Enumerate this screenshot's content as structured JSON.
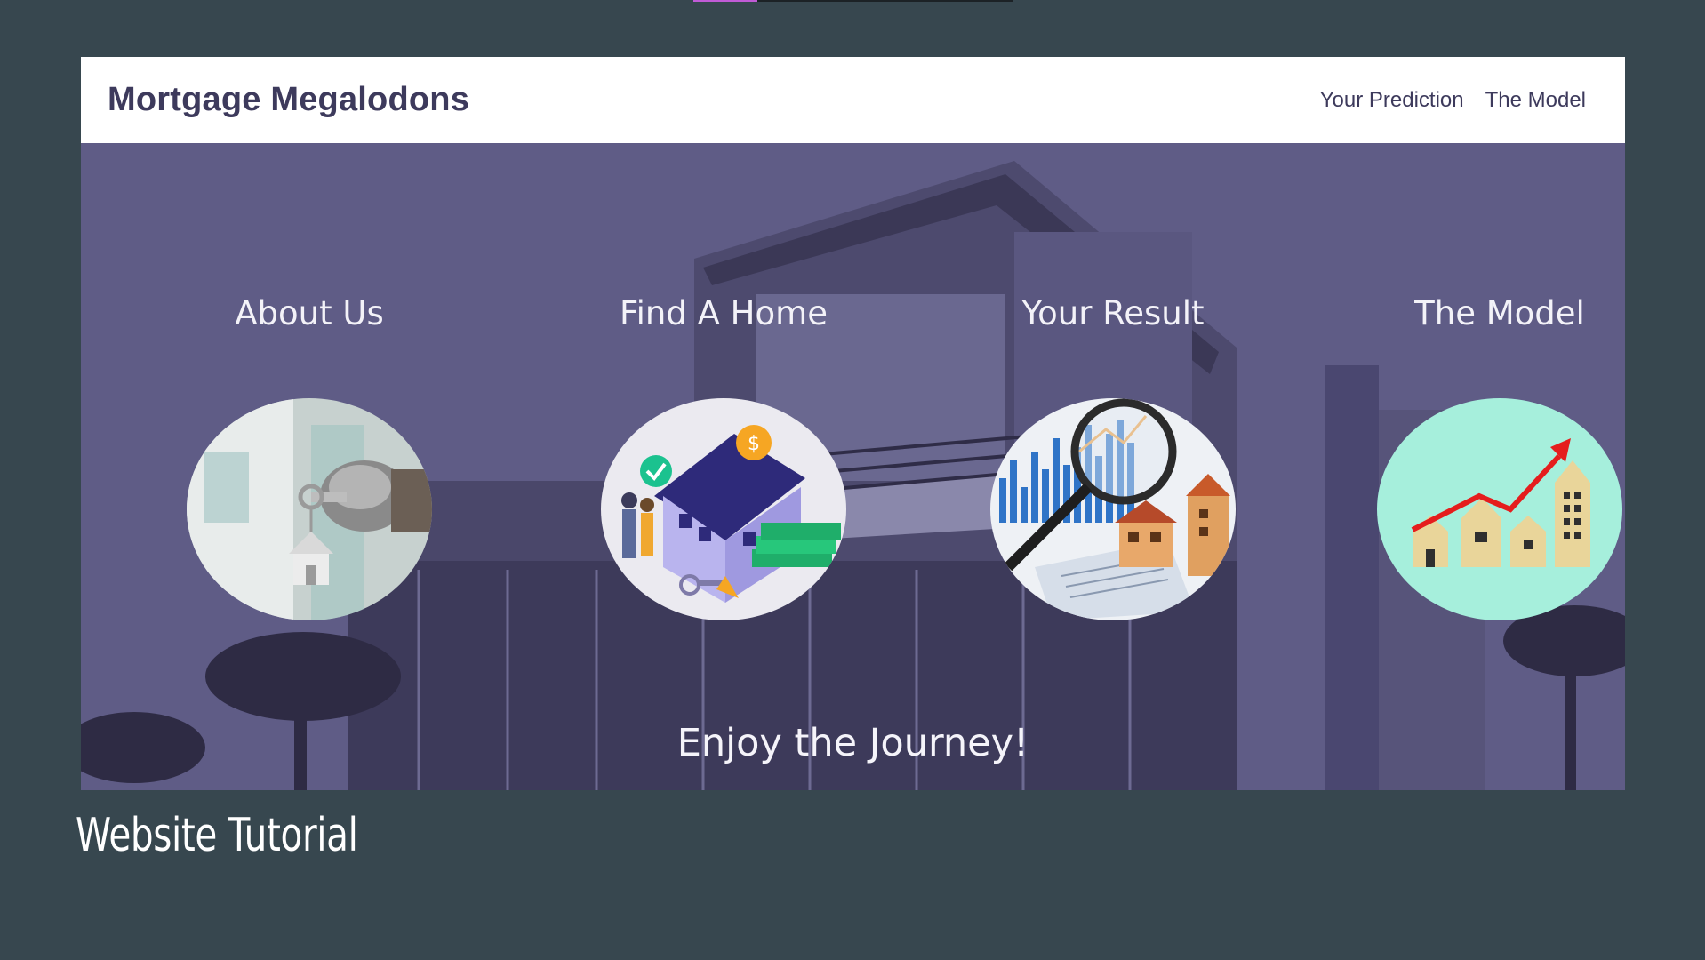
{
  "brand": "Mortgage Megalodons",
  "nav": {
    "links": [
      {
        "label": "Your Prediction"
      },
      {
        "label": "The Model"
      }
    ]
  },
  "hero": {
    "sections": [
      {
        "title": "About Us",
        "image_icon": "key-in-door-house-icon"
      },
      {
        "title": "Find A Home",
        "image_icon": "house-with-money-icon"
      },
      {
        "title": "Your Result",
        "image_icon": "magnifier-chart-icon"
      },
      {
        "title": "The Model",
        "image_icon": "growth-arrow-houses-icon"
      }
    ],
    "tagline": "Enjoy the Journey!"
  },
  "slide": {
    "caption": "Website Tutorial",
    "progress": 0.2
  },
  "colors": {
    "slide_background": "#37474f",
    "brand_text": "#3d3a5c",
    "hero_overlay": "#5e5b84",
    "progress_accent": "#c05bd6"
  }
}
